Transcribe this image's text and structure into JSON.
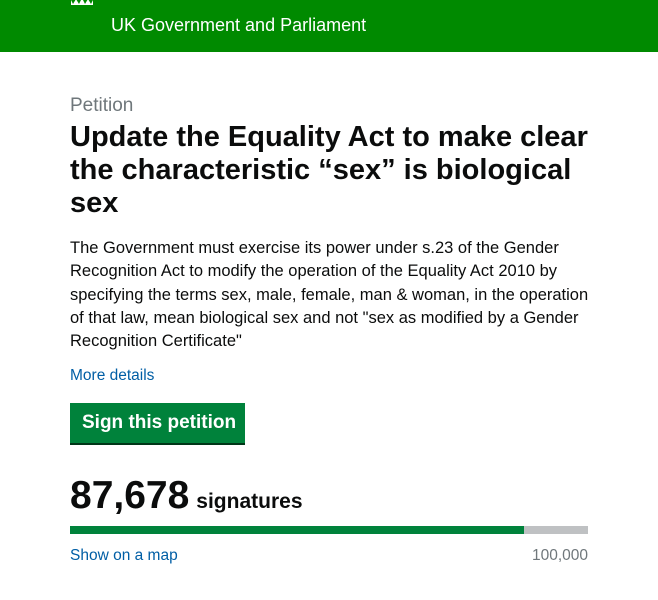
{
  "header": {
    "title": "UK Government and Parliament",
    "logo_icon": "crown-icon",
    "brand_color": "#008a00"
  },
  "petition": {
    "kicker": "Petition",
    "title": "Update the Equality Act to make clear the characteristic “sex” is biological sex",
    "description": "The Government must exercise its power under s.23 of the Gender Recognition Act to modify the operation of the Equality Act 2010 by specifying the terms sex, male, female, man & woman, in the operation of that law, mean biological sex and not \"sex as modified by a Gender Recognition Certificate\"",
    "more_details_label": "More details",
    "sign_button_label": "Sign this petition",
    "button_color": "#00823b"
  },
  "signatures": {
    "count_display": "87,678",
    "label": "signatures",
    "count_value": 87678,
    "target_display": "100,000",
    "target_value": 100000,
    "progress_fraction": 0.87678,
    "show_on_map_label": "Show on a map"
  },
  "colors": {
    "link": "#005ea5",
    "muted_text": "#6f777b",
    "progress_track": "#bfc1c3",
    "progress_fill": "#00823b"
  }
}
